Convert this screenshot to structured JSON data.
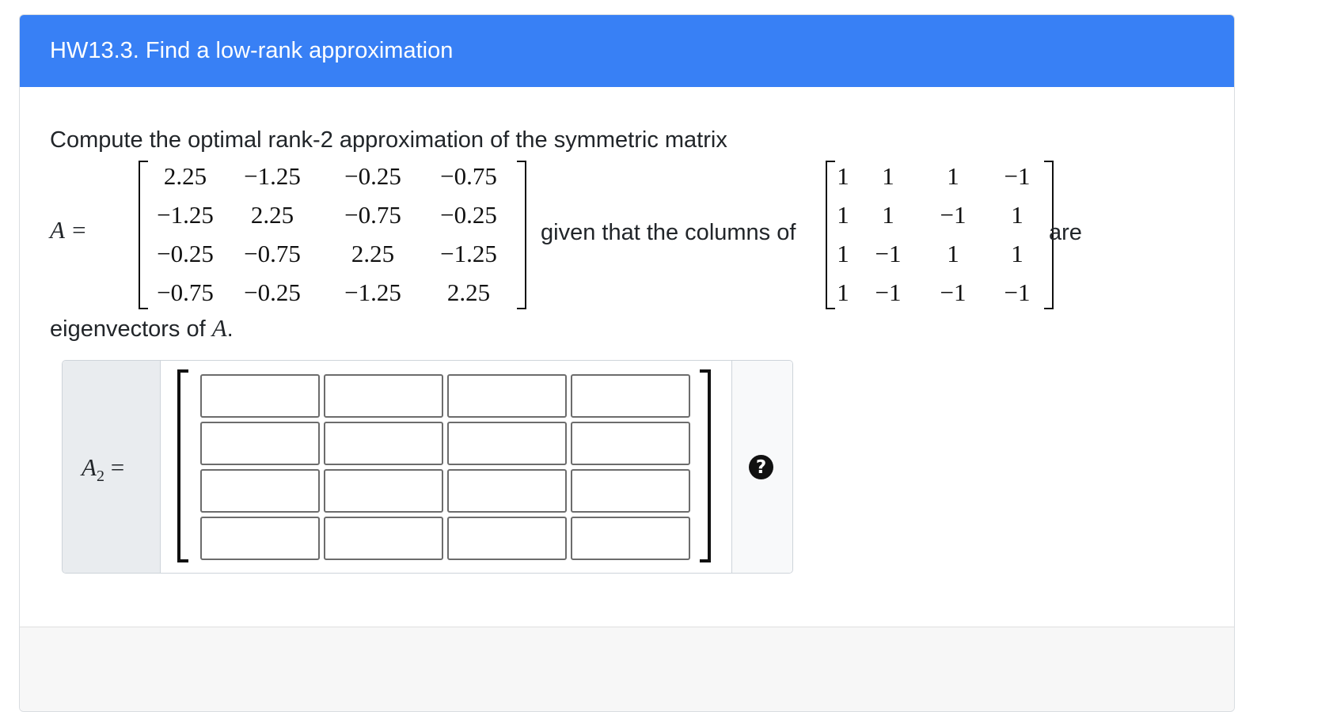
{
  "question": {
    "title": "HW13.3. Find a low-rank approximation",
    "prompt_text": "Compute the optimal rank-2 approximation of the symmetric matrix",
    "matrix_label": "A =",
    "matrix_A": [
      [
        "2.25",
        "−1.25",
        "−0.25",
        "−0.75"
      ],
      [
        "−1.25",
        "2.25",
        "−0.75",
        "−0.25"
      ],
      [
        "−0.25",
        "−0.75",
        "2.25",
        "−1.25"
      ],
      [
        "−0.75",
        "−0.25",
        "−1.25",
        "2.25"
      ]
    ],
    "given_text": "given that the columns of",
    "eigen_matrix": [
      [
        "1",
        "1",
        "1",
        "−1"
      ],
      [
        "1",
        "1",
        "−1",
        "1"
      ],
      [
        "1",
        "−1",
        "1",
        "1"
      ],
      [
        "1",
        "−1",
        "−1",
        "−1"
      ]
    ],
    "are_text": "are",
    "eigenvectors_text": "eigenvectors of",
    "eigenvectors_symbol": "A",
    "eigenvectors_period": "."
  },
  "answer": {
    "label_symbol": "A",
    "label_subscript": "2",
    "label_equals": "=",
    "cells": [
      [
        "",
        "",
        "",
        ""
      ],
      [
        "",
        "",
        "",
        ""
      ],
      [
        "",
        "",
        "",
        ""
      ],
      [
        "",
        "",
        "",
        ""
      ]
    ],
    "help_icon_glyph": "?"
  },
  "icons": {
    "help": "question-circle-icon"
  },
  "colors": {
    "header_bg": "#3880f5",
    "header_text": "#ffffff",
    "prefix_bg": "#e9ecef"
  }
}
